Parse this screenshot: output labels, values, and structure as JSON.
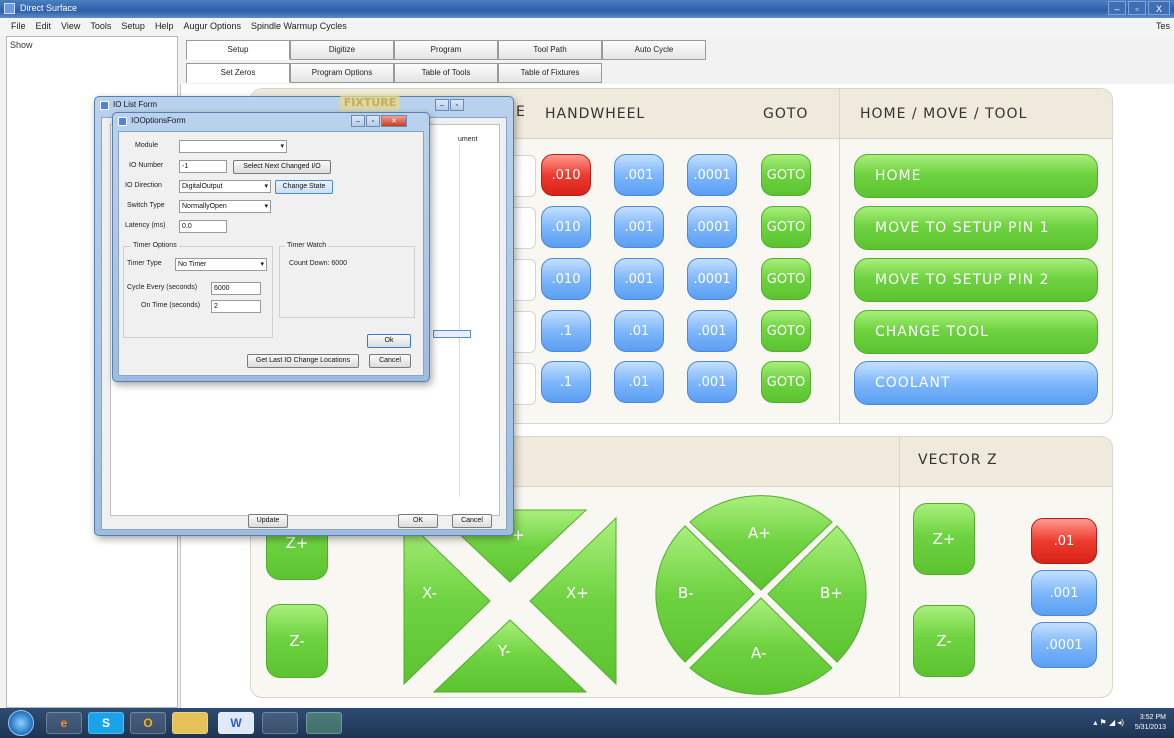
{
  "window": {
    "title": "Direct Surface",
    "controls": [
      "–",
      "▫",
      "X"
    ]
  },
  "menu": {
    "items": [
      "File",
      "Edit",
      "View",
      "Tools",
      "Setup",
      "Help",
      "Augur Options",
      "Spindle Warmup Cycles"
    ],
    "right_text": "Tes"
  },
  "left_panel": {
    "label": "Show"
  },
  "tabs_main": [
    "Setup",
    "Digitize",
    "Program",
    "Tool Path",
    "Auto Cycle"
  ],
  "tabs_sub": [
    "Set Zeros",
    "Program Options",
    "Table of Tools",
    "Table of Fixtures"
  ],
  "headers": {
    "partial_e": "E",
    "handwheel": "HANDWHEEL",
    "goto": "GOTO",
    "home_move_tool": "HOME / MOVE / TOOL",
    "vector_z": "VECTOR Z"
  },
  "handwheel_rows": [
    {
      "a": ".010",
      "a_color": "red",
      "b": ".001",
      "c": ".0001",
      "goto": "GOTO"
    },
    {
      "a": ".010",
      "a_color": "blue",
      "b": ".001",
      "c": ".0001",
      "goto": "GOTO"
    },
    {
      "a": ".010",
      "a_color": "blue",
      "b": ".001",
      "c": ".0001",
      "goto": "GOTO"
    },
    {
      "a": ".1",
      "a_color": "blue",
      "b": ".01",
      "c": ".001",
      "goto": "GOTO"
    },
    {
      "a": ".1",
      "a_color": "blue",
      "b": ".01",
      "c": ".001",
      "goto": "GOTO"
    }
  ],
  "home_buttons": [
    {
      "label": "HOME",
      "color": "green"
    },
    {
      "label": "MOVE TO SETUP PIN 1",
      "color": "green"
    },
    {
      "label": "MOVE TO SETUP PIN 2",
      "color": "green"
    },
    {
      "label": "CHANGE TOOL",
      "color": "green"
    },
    {
      "label": "COOLANT",
      "color": "blue"
    }
  ],
  "jog": {
    "z_plus": "Z+",
    "z_minus": "Z-",
    "x_minus": "X-",
    "x_plus": "X+",
    "y_plus": "+",
    "y_minus": "Y-"
  },
  "rotary": {
    "a_plus": "A+",
    "a_minus": "A-",
    "b_minus": "B-",
    "b_plus": "B+"
  },
  "vector_z": {
    "z_plus": "Z+",
    "z_minus": "Z-",
    "steps": [
      ".01",
      ".001",
      ".0001"
    ]
  },
  "io_list_form": {
    "title": "IO List Form",
    "behind_text": "FIXTURE",
    "partial_column": "ument",
    "update_label": "Update",
    "ok_label": "OK",
    "cancel_label": "Cancel"
  },
  "io_options_form": {
    "title": "IOOptionsForm",
    "module_label": "Module",
    "module_value": "",
    "io_number_label": "IO Number",
    "io_number_value": "-1",
    "select_next_label": "Select Next Changed I/O",
    "io_direction_label": "IO Direction",
    "io_direction_value": "DigitalOutput",
    "change_state_label": "Change State",
    "switch_type_label": "Switch Type",
    "switch_type_value": "NormallyOpen",
    "latency_label": "Latency (ms)",
    "latency_value": "0.0",
    "timer_options_label": "Timer Options",
    "timer_type_label": "Timer Type",
    "timer_type_value": "No Timer",
    "cycle_every_label": "Cycle Every (seconds)",
    "cycle_every_value": "6000",
    "on_time_label": "On Time (seconds)",
    "on_time_value": "2",
    "timer_watch_label": "Timer Watch",
    "count_down_label": "Count Down: 6000",
    "ok_label": "Ok",
    "get_last_label": "Get Last IO Change Locations",
    "cancel_label": "Cancel"
  },
  "taskbar": {
    "apps": [
      "e",
      "S",
      "O",
      "W",
      "",
      ""
    ],
    "clock_time": "3:52 PM",
    "clock_date": "5/31/2013"
  }
}
